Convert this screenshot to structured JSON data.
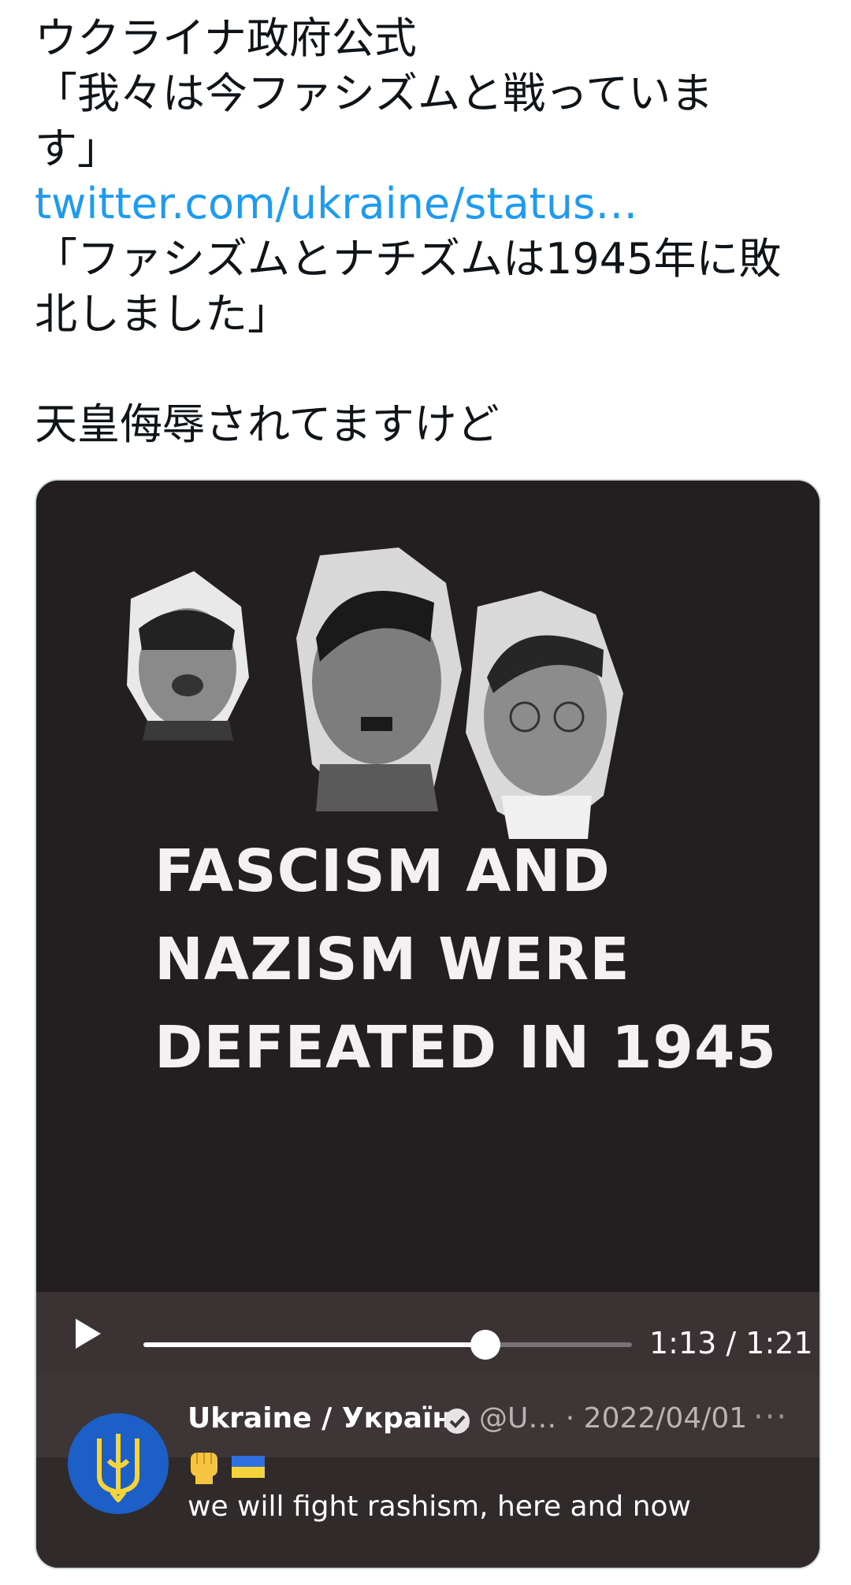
{
  "tweet": {
    "line1": "ウクライナ政府公式",
    "line2": "「我々は今ファシズムと戦っていま",
    "line3": "す」",
    "link": "twitter.com/ukraine/status…",
    "line4": "「ファシズムとナチズムは1945年に敗",
    "line5": "北しました」",
    "line6": "天皇侮辱されてますけど"
  },
  "video": {
    "headline": [
      "FASCISM AND",
      "NAZISM WERE",
      "DEFEATED IN 1945"
    ],
    "progress": 0.7,
    "time_display": "1:13 / 1:21"
  },
  "embed": {
    "name": "Ukraine / Україна",
    "handle_date": "@U… · 2022/04/01",
    "more": "···",
    "emoji": "✊ 🇺🇦",
    "text": "we will fight rashism, here and now"
  },
  "colors": {
    "link": "#1d9bf0",
    "video_bg": "#231f20",
    "avatar_bg": "#1c60c7",
    "trident": "#f5d33a"
  },
  "icons": [
    "play-icon",
    "verified-badge-icon",
    "more-icon",
    "trident-icon",
    "raised-fist-icon",
    "ukraine-flag-icon"
  ]
}
